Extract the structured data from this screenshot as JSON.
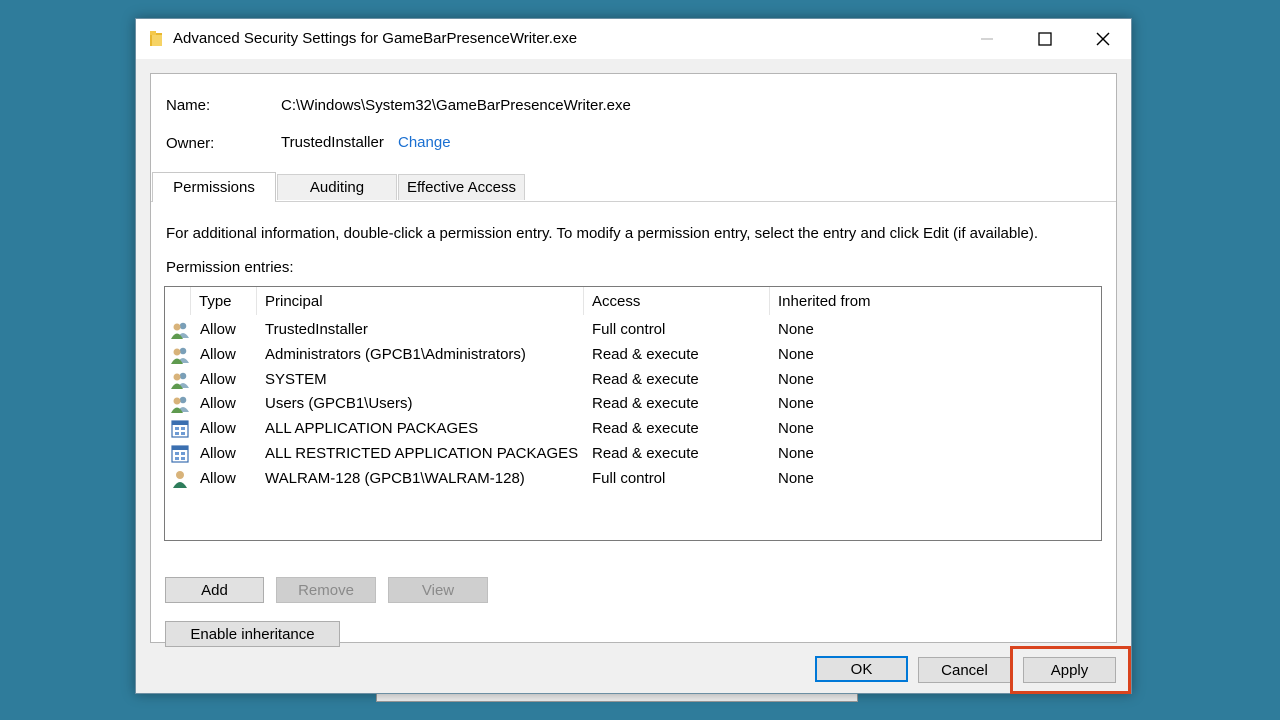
{
  "window": {
    "title": "Advanced Security Settings for GameBarPresenceWriter.exe"
  },
  "info": {
    "name_label": "Name:",
    "name_value": "C:\\Windows\\System32\\GameBarPresenceWriter.exe",
    "owner_label": "Owner:",
    "owner_value": "TrustedInstaller",
    "change_link": "Change"
  },
  "tabs": [
    {
      "label": "Permissions",
      "active": true
    },
    {
      "label": "Auditing",
      "active": false
    },
    {
      "label": "Effective Access",
      "active": false
    }
  ],
  "instructions": "For additional information, double-click a permission entry. To modify a permission entry, select the entry and click Edit (if available).",
  "entries_label": "Permission entries:",
  "table": {
    "columns": [
      "Type",
      "Principal",
      "Access",
      "Inherited from"
    ],
    "rows": [
      {
        "icon": "user-group-icon",
        "type": "Allow",
        "principal": "TrustedInstaller",
        "access": "Full control",
        "inherited": "None"
      },
      {
        "icon": "user-group-icon",
        "type": "Allow",
        "principal": "Administrators (GPCB1\\Administrators)",
        "access": "Read & execute",
        "inherited": "None"
      },
      {
        "icon": "user-group-icon",
        "type": "Allow",
        "principal": "SYSTEM",
        "access": "Read & execute",
        "inherited": "None"
      },
      {
        "icon": "user-group-icon",
        "type": "Allow",
        "principal": "Users (GPCB1\\Users)",
        "access": "Read & execute",
        "inherited": "None"
      },
      {
        "icon": "app-package-icon",
        "type": "Allow",
        "principal": "ALL APPLICATION PACKAGES",
        "access": "Read & execute",
        "inherited": "None"
      },
      {
        "icon": "app-package-icon",
        "type": "Allow",
        "principal": "ALL RESTRICTED APPLICATION PACKAGES",
        "access": "Read & execute",
        "inherited": "None"
      },
      {
        "icon": "single-user-icon",
        "type": "Allow",
        "principal": "WALRAM-128 (GPCB1\\WALRAM-128)",
        "access": "Full control",
        "inherited": "None"
      }
    ]
  },
  "buttons": {
    "add": "Add",
    "remove": "Remove",
    "view": "View",
    "enable_inheritance": "Enable inheritance",
    "ok": "OK",
    "cancel": "Cancel",
    "apply": "Apply"
  },
  "colors": {
    "desktop": "#2f7c9b",
    "link": "#1a6fd1",
    "highlight": "#d9441e",
    "default_button_border": "#0078d7"
  }
}
